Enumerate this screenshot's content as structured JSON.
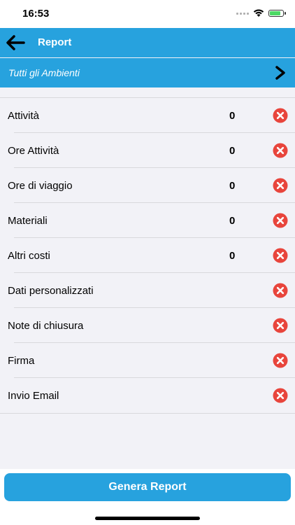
{
  "status_bar": {
    "time": "16:53"
  },
  "nav": {
    "title": "Report"
  },
  "environment": {
    "label": "Tutti gli Ambienti"
  },
  "rows": [
    {
      "label": "Attività",
      "value": "0"
    },
    {
      "label": "Ore Attività",
      "value": "0"
    },
    {
      "label": "Ore di viaggio",
      "value": "0"
    },
    {
      "label": "Materiali",
      "value": "0"
    },
    {
      "label": "Altri costi",
      "value": "0"
    },
    {
      "label": "Dati personalizzati",
      "value": ""
    },
    {
      "label": "Note di chiusura",
      "value": ""
    },
    {
      "label": "Firma",
      "value": ""
    },
    {
      "label": "Invio Email",
      "value": ""
    }
  ],
  "footer": {
    "generate_label": "Genera Report"
  },
  "colors": {
    "accent": "#27a2de",
    "remove": "#e8453c"
  },
  "icons": {
    "back": "arrow-left-icon",
    "chevron": "chevron-right-icon",
    "remove": "remove-x-icon"
  }
}
